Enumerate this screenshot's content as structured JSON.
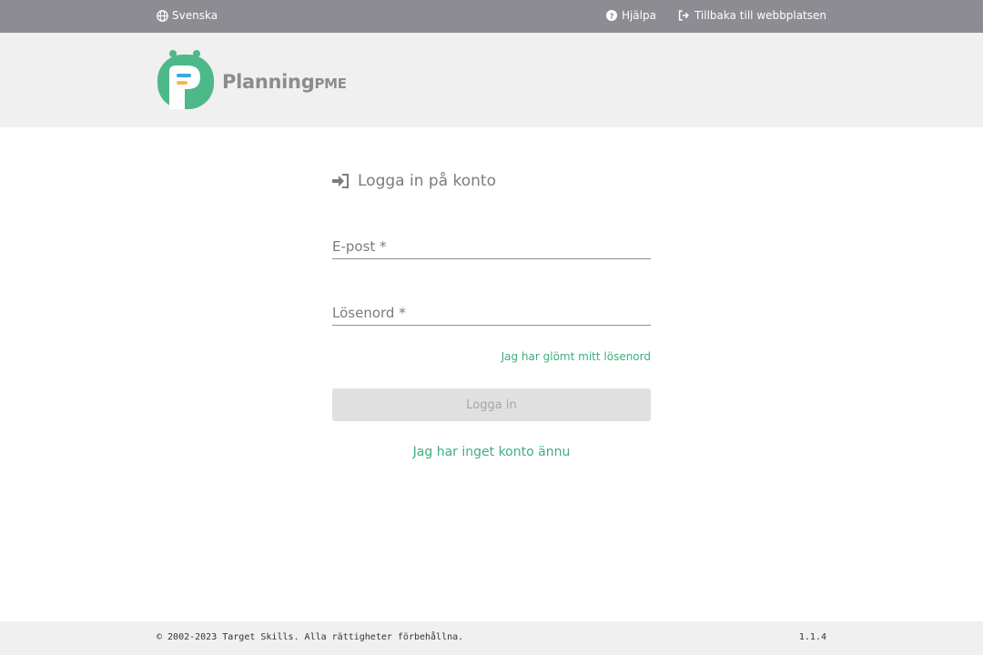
{
  "topbar": {
    "language": "Svenska",
    "help": "Hjälpa",
    "back_to_site": "Tillbaka till webbplatsen"
  },
  "logo": {
    "brand_main": "Planning",
    "brand_suffix": "PME",
    "colors": {
      "green": "#4db889",
      "blue": "#3da7e0",
      "yellow": "#f4b942"
    }
  },
  "login": {
    "title": "Logga in på konto",
    "email_placeholder": "E-post *",
    "password_placeholder": "Lösenord *",
    "forgot_password": "Jag har glömt mitt lösenord",
    "login_button": "Logga in",
    "no_account": "Jag har inget konto ännu"
  },
  "footer": {
    "copyright": "© 2002-2023 Target Skills. Alla rättigheter förbehållna.",
    "version": "1.1.4"
  },
  "colors": {
    "topbar": "#8c8c92",
    "header_bg": "#f0f0f0",
    "accent_green": "#3fae7d",
    "button_disabled": "#e0e0e0"
  }
}
